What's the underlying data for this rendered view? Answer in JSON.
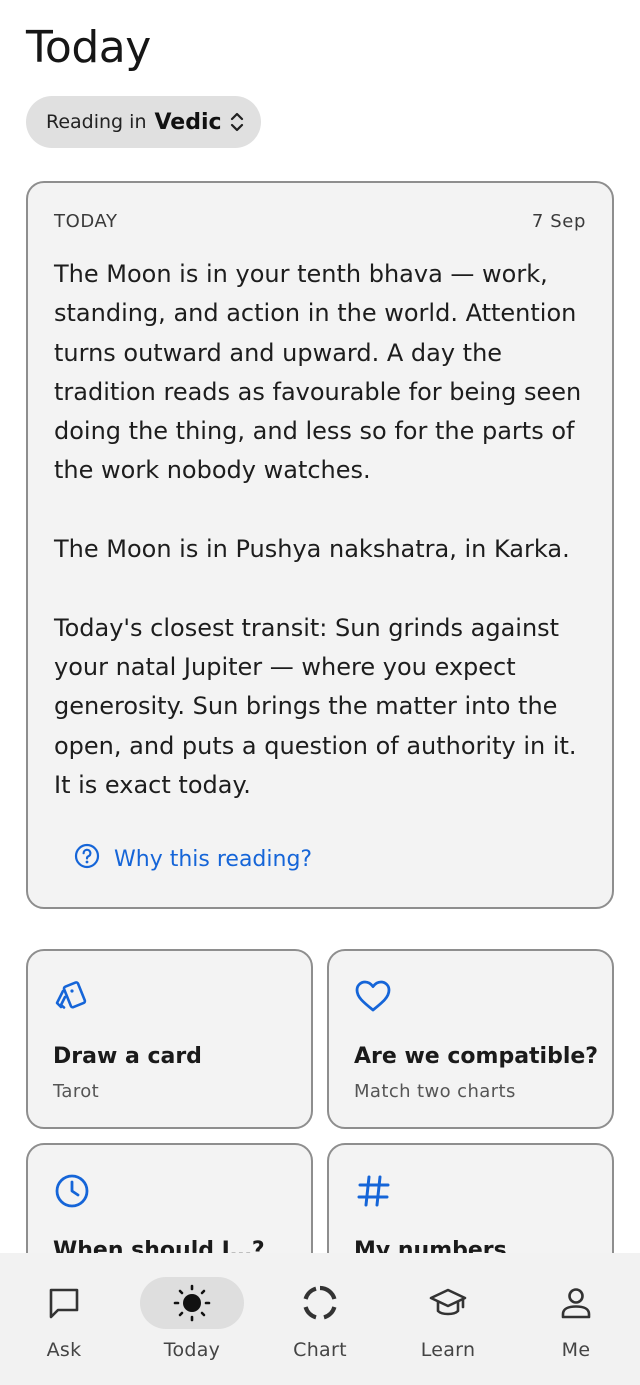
{
  "page": {
    "title": "Today"
  },
  "reading_selector": {
    "prefix": "Reading in",
    "system": "Vedic",
    "icon": "unfold-chevron-icon"
  },
  "today_card": {
    "label": "TODAY",
    "date": "7 Sep",
    "paragraphs": [
      "The Moon is in your tenth bhava — work, standing, and action in the world. Attention turns outward and upward. A day the tradition reads as favourable for being seen doing the thing, and less so for the parts of the work nobody watches.",
      "The Moon is in Pushya nakshatra, in Karka.",
      "Today's closest transit: Sun grinds against your natal Jupiter — where you expect generosity. Sun brings the matter into the open, and puts a question of authority in it. It is exact today."
    ],
    "why_link": {
      "label": "Why this reading?",
      "icon": "help-circle-icon"
    }
  },
  "tiles": [
    {
      "title": "Draw a card",
      "subtitle": "Tarot",
      "icon": "cards-icon"
    },
    {
      "title": "Are we compatible?",
      "subtitle": "Match two charts",
      "icon": "heart-icon"
    },
    {
      "title": "When should I…?",
      "subtitle": "",
      "icon": "clock-icon"
    },
    {
      "title": "My numbers",
      "subtitle": "",
      "icon": "hash-icon"
    }
  ],
  "tabbar": {
    "active": "Today",
    "tabs": [
      {
        "label": "Ask",
        "icon": "chat-bubble-icon"
      },
      {
        "label": "Today",
        "icon": "sun-icon"
      },
      {
        "label": "Chart",
        "icon": "chart-ring-icon"
      },
      {
        "label": "Learn",
        "icon": "graduation-cap-icon"
      },
      {
        "label": "Me",
        "icon": "person-icon"
      }
    ]
  },
  "colors": {
    "accent": "#1565d8",
    "card_bg": "#f3f3f3",
    "card_border": "#8e8e8e",
    "pill_bg": "#e0e0e0",
    "tabbar_bg": "#f2f2f2"
  }
}
